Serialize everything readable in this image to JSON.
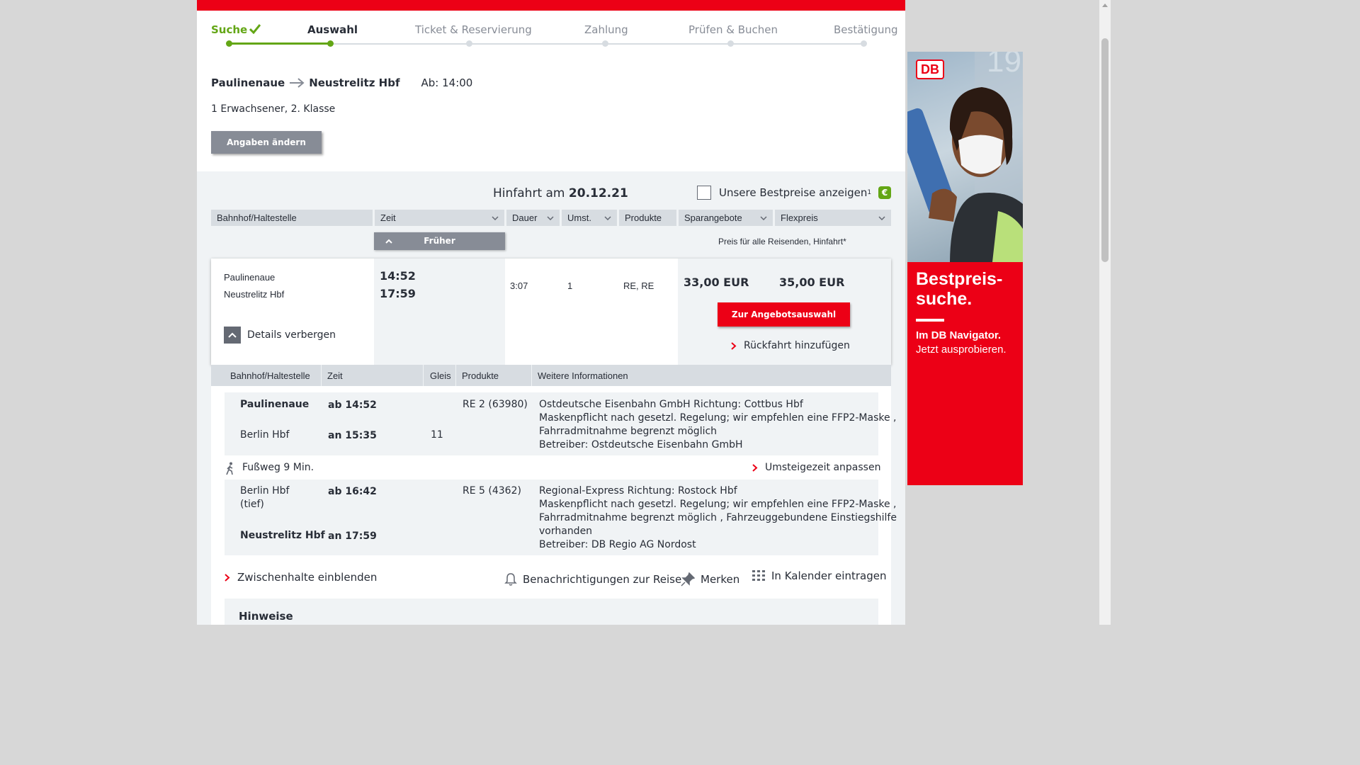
{
  "steps": [
    {
      "label": "Suche",
      "state": "done"
    },
    {
      "label": "Auswahl",
      "state": "active"
    },
    {
      "label": "Ticket & Reservierung",
      "state": "pending"
    },
    {
      "label": "Zahlung",
      "state": "pending"
    },
    {
      "label": "Prüfen & Buchen",
      "state": "pending"
    },
    {
      "label": "Bestätigung",
      "state": "pending"
    }
  ],
  "summary": {
    "from": "Paulinenaue",
    "to": "Neustrelitz Hbf",
    "departure": "Ab: 14:00",
    "passengers": "1 Erwachsener, 2. Klasse",
    "change_button": "Angaben ändern"
  },
  "results": {
    "date_prefix": "Hinfahrt am",
    "date": "20.12.21",
    "bestprice_label": "Unsere Bestpreise anzeigen",
    "bestprice_sup": "1",
    "bestprice_badge": "€",
    "columns": {
      "station": "Bahnhof/Haltestelle",
      "time": "Zeit",
      "duration": "Dauer",
      "changes": "Umst.",
      "products": "Produkte",
      "saver": "Sparangebote",
      "flex": "Flexpreis"
    },
    "earlier_button": "Früher",
    "price_note": "Preis für alle Reisenden, Hinfahrt*"
  },
  "connection": {
    "from": "Paulinenaue",
    "to": "Neustrelitz Hbf",
    "dep_time": "14:52",
    "arr_time": "17:59",
    "duration": "3:07",
    "changes": "1",
    "products": "RE, RE",
    "saver_price": "33,00 EUR",
    "flex_price": "35,00 EUR",
    "offer_button": "Zur Angebotsauswahl",
    "return_link": "Rückfahrt hinzufügen",
    "details_toggle": "Details verbergen"
  },
  "details": {
    "columns": {
      "station": "Bahnhof/Haltestelle",
      "time": "Zeit",
      "platform": "Gleis",
      "products": "Produkte",
      "info": "Weitere Informationen"
    },
    "leg1": {
      "dep_station": "Paulinenaue",
      "dep_time": "ab 14:52",
      "arr_station": "Berlin Hbf",
      "arr_time": "an 15:35",
      "arr_platform": "11",
      "product": "RE 2 (63980)",
      "info": [
        "Ostdeutsche Eisenbahn GmbH Richtung: Cottbus Hbf",
        "Maskenpflicht nach gesetzl. Regelung; wir empfehlen eine FFP2-Maske ,",
        "Fahrradmitnahme begrenzt möglich",
        "Betreiber: Ostdeutsche Eisenbahn GmbH"
      ]
    },
    "transfer": {
      "walk": "Fußweg 9 Min.",
      "adjust_link": "Umsteigezeit anpassen"
    },
    "leg2": {
      "dep_station_line1": "Berlin Hbf",
      "dep_station_line2": "(tief)",
      "dep_time": "ab 16:42",
      "arr_station": "Neustrelitz Hbf",
      "arr_time": "an 17:59",
      "product": "RE 5 (4362)",
      "info": [
        "Regional-Express Richtung: Rostock Hbf",
        "Maskenpflicht nach gesetzl. Regelung; wir empfehlen eine FFP2-Maske ,",
        "Fahrradmitnahme begrenzt möglich , Fahrzeuggebundene Einstiegshilfe",
        "vorhanden",
        "Betreiber: DB Regio AG Nordost"
      ]
    },
    "actions": {
      "intermediate_stops": "Zwischenhalte einblenden",
      "notifications": "Benachrichtigungen zur Reise",
      "bookmark": "Merken",
      "calendar": "In Kalender eintragen"
    },
    "notes_title": "Hinweise"
  },
  "ad": {
    "logo": "DB",
    "headline_line1": "Bestpreis-",
    "headline_line2": "suche.",
    "sub1": "Im DB Navigator.",
    "sub2": "Jetzt ausprobieren."
  },
  "colors": {
    "db_red": "#ec0016",
    "progress_green": "#63a615",
    "button_grey": "#878c96",
    "panel_grey": "#f0f3f5"
  }
}
